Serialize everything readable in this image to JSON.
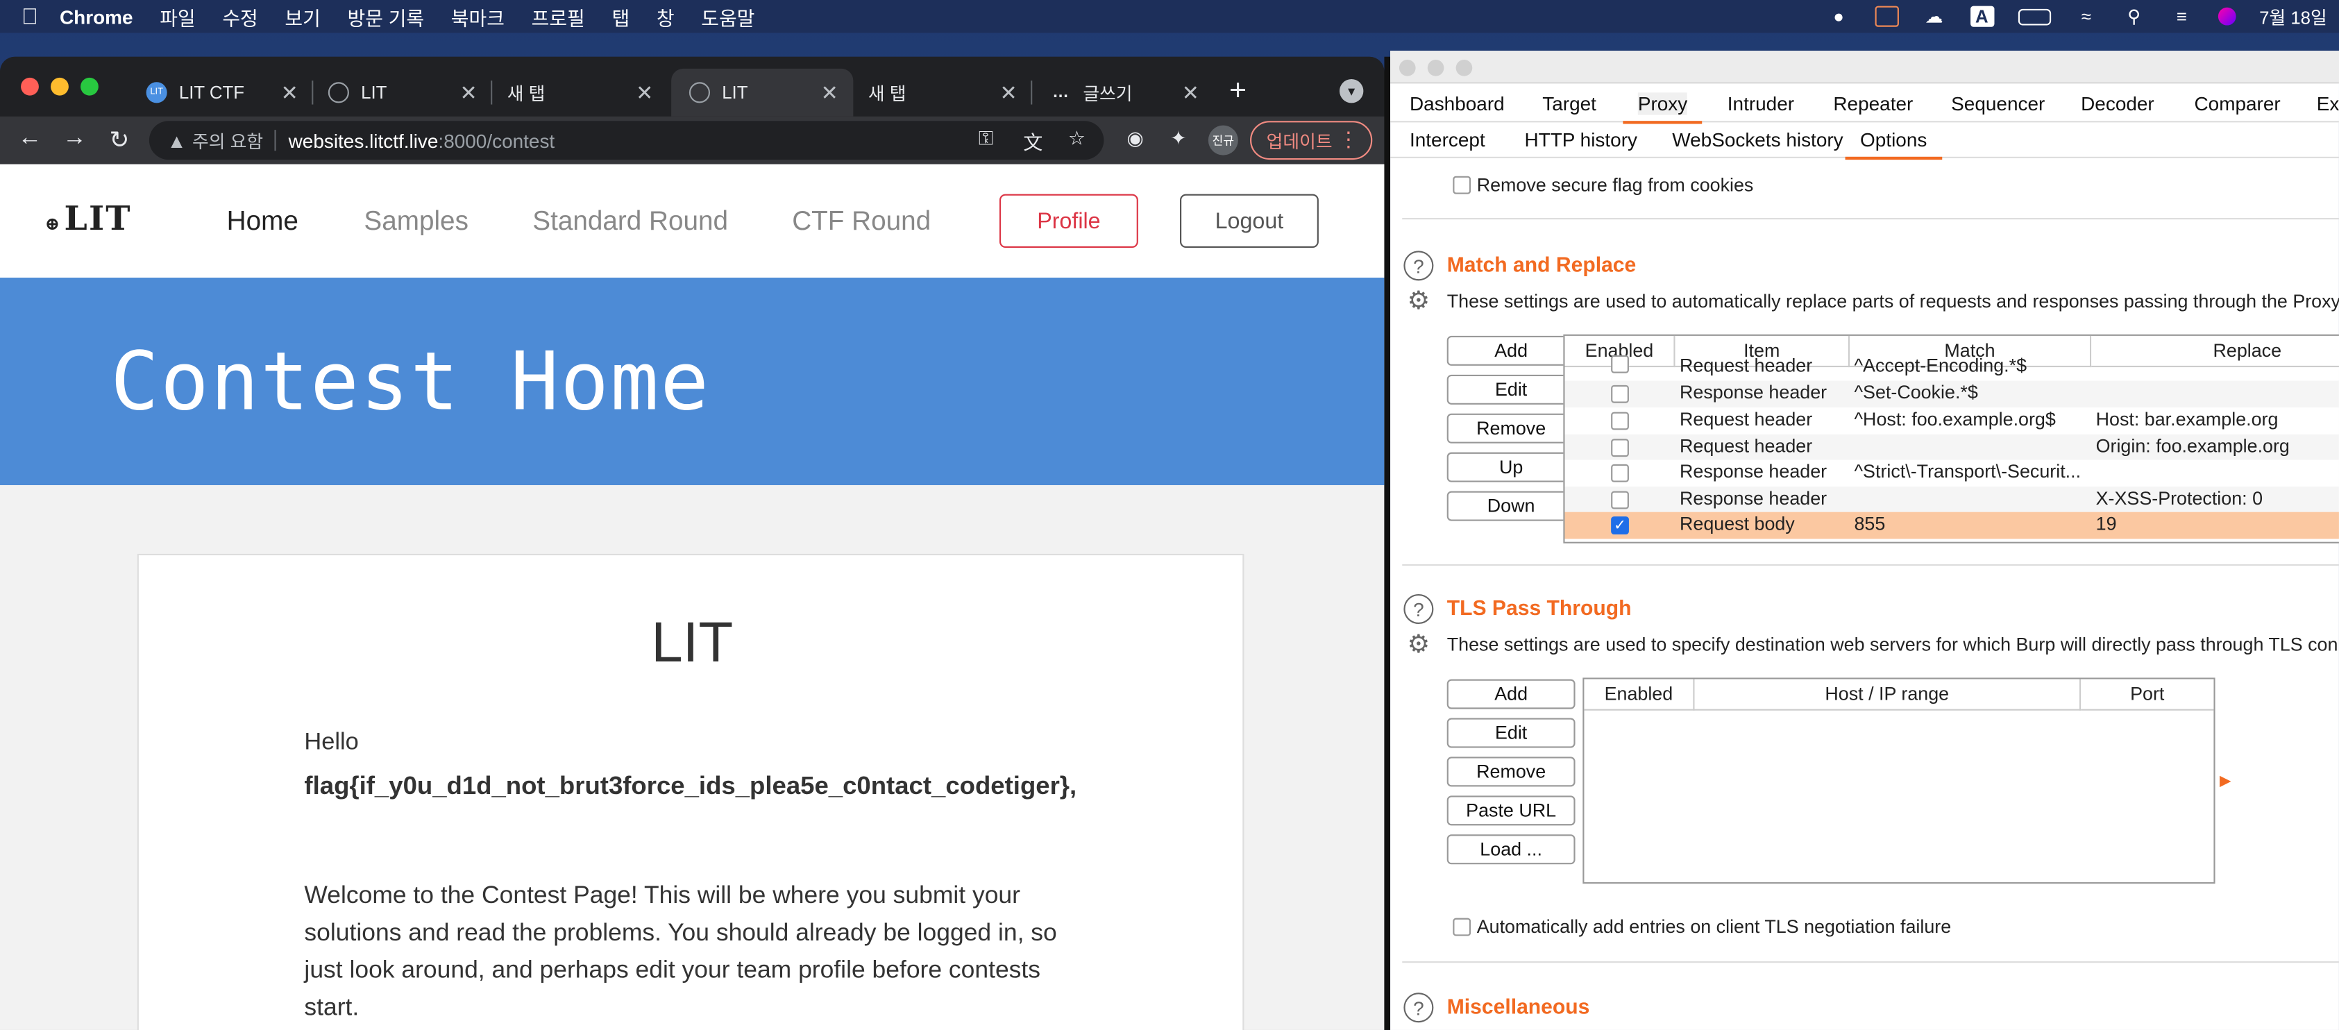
{
  "menubar": {
    "app_name": "Chrome",
    "items": [
      "파일",
      "수정",
      "보기",
      "방문 기록",
      "북마크",
      "프로필",
      "탭",
      "창",
      "도움말"
    ],
    "clock": "7월 18일"
  },
  "chrome": {
    "tabs": [
      {
        "label": "LIT CTF",
        "favicon": "lit-logo-icon"
      },
      {
        "label": "LIT",
        "favicon": "globe-icon"
      },
      {
        "label": "새 탭",
        "favicon": ""
      },
      {
        "label": "LIT",
        "favicon": "globe-icon"
      },
      {
        "label": "새 탭",
        "favicon": ""
      },
      {
        "label": "글쓰기",
        "favicon": "tistory-icon"
      }
    ],
    "active_tab": 3,
    "omnibox": {
      "warning": "주의 요함",
      "host": "websites.litctf.live",
      "rest": ":8000/contest"
    },
    "profile_badge": "진규",
    "update_label": "업데이트"
  },
  "site": {
    "logo_text": "LIT",
    "nav": [
      "Home",
      "Samples",
      "Standard Round",
      "CTF Round"
    ],
    "profile_button": "Profile",
    "logout_button": "Logout",
    "hero_title": "Contest Home",
    "card_title": "LIT",
    "hello": "Hello",
    "flag": "flag{if_y0u_d1d_not_brut3force_ids_plea5e_c0ntact_codetiger},",
    "welcome": "Welcome to the Contest Page! This will be where you submit your solutions and read the problems. You should already be logged in, so just look around, and perhaps edit your team profile before contests start."
  },
  "burp": {
    "main_tabs": [
      "Dashboard",
      "Target",
      "Proxy",
      "Intruder",
      "Repeater",
      "Sequencer",
      "Decoder",
      "Comparer",
      "Ex"
    ],
    "selected_main_tab": "Proxy",
    "sub_tabs": [
      "Intercept",
      "HTTP history",
      "WebSockets history",
      "Options"
    ],
    "selected_sub_tab": "Options",
    "remove_secure_flag": "Remove secure flag from cookies",
    "match_replace": {
      "title": "Match and Replace",
      "description": "These settings are used to automatically replace parts of requests and responses passing through the Proxy.",
      "buttons": [
        "Add",
        "Edit",
        "Remove",
        "Up",
        "Down"
      ],
      "columns": [
        "Enabled",
        "Item",
        "Match",
        "Replace"
      ],
      "rows": [
        {
          "enabled": false,
          "item": "Request header",
          "match": "^Accept-Encoding.*$",
          "replace": ""
        },
        {
          "enabled": false,
          "item": "Response header",
          "match": "^Set-Cookie.*$",
          "replace": ""
        },
        {
          "enabled": false,
          "item": "Request header",
          "match": "^Host: foo.example.org$",
          "replace": "Host: bar.example.org"
        },
        {
          "enabled": false,
          "item": "Request header",
          "match": "",
          "replace": "Origin: foo.example.org"
        },
        {
          "enabled": false,
          "item": "Response header",
          "match": "^Strict\\-Transport\\-Securit...",
          "replace": ""
        },
        {
          "enabled": false,
          "item": "Response header",
          "match": "",
          "replace": "X-XSS-Protection: 0"
        },
        {
          "enabled": true,
          "item": "Request body",
          "match": "855",
          "replace": "19"
        }
      ]
    },
    "tls": {
      "title": "TLS Pass Through",
      "description": "These settings are used to specify destination web servers for which Burp will directly pass through TLS conn",
      "buttons": [
        "Add",
        "Edit",
        "Remove",
        "Paste URL",
        "Load ..."
      ],
      "columns": [
        "Enabled",
        "Host / IP range",
        "Port"
      ],
      "auto_add": "Automatically add entries on client TLS negotiation failure"
    },
    "misc_title": "Miscellaneous"
  },
  "colors": {
    "accent_orange": "#f26a21",
    "hero_blue": "#4d8bd6",
    "profile_red": "#dc3545"
  }
}
